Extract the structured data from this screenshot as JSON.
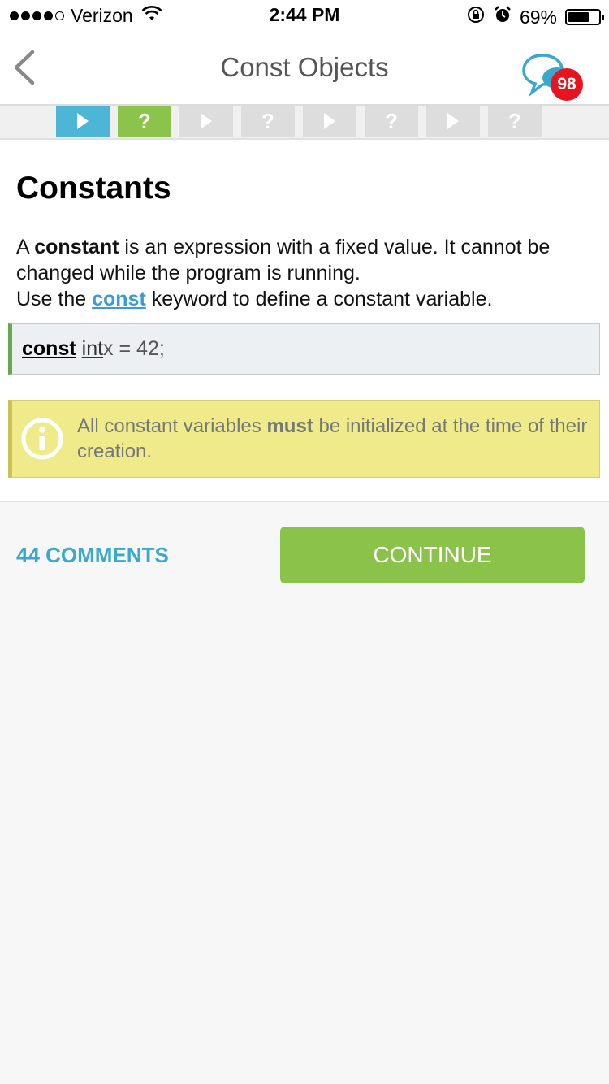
{
  "status_bar": {
    "carrier": "Verizon",
    "time": "2:44 PM",
    "battery_percent": "69%",
    "battery_level": 0.69,
    "signal_bars": 4,
    "icons": [
      "wifi-icon",
      "orientation-lock-icon",
      "alarm-icon",
      "battery-icon"
    ]
  },
  "nav": {
    "title": "Const Objects",
    "back_icon": "chevron-left-icon",
    "chat_icon": "chat-bubbles-icon",
    "badge_count": "98"
  },
  "steps": [
    {
      "type": "play",
      "symbol": "",
      "state": "active"
    },
    {
      "type": "quiz",
      "symbol": "?",
      "state": "active"
    },
    {
      "type": "play",
      "symbol": "",
      "state": "inactive"
    },
    {
      "type": "quiz",
      "symbol": "?",
      "state": "inactive"
    },
    {
      "type": "play",
      "symbol": "",
      "state": "inactive"
    },
    {
      "type": "quiz",
      "symbol": "?",
      "state": "inactive"
    },
    {
      "type": "play",
      "symbol": "",
      "state": "inactive"
    },
    {
      "type": "quiz",
      "symbol": "?",
      "state": "inactive"
    }
  ],
  "lesson": {
    "heading": "Constants",
    "p1_a": "A ",
    "p1_bold": "constant",
    "p1_b": " is an expression with a fixed value. It cannot be changed while the program is running.",
    "p2_a": "Use the ",
    "p2_link": "const",
    "p2_b": " keyword to define a constant variable.",
    "code": {
      "keyword": "const",
      "type": "int",
      "rest": " x = 42;"
    },
    "info": {
      "icon": "info-icon",
      "text_a": "All constant variables ",
      "text_bold": "must",
      "text_b": " be initialized at the time of their creation."
    }
  },
  "actions": {
    "comments_label": "44 COMMENTS",
    "continue_label": "CONTINUE"
  },
  "colors": {
    "accent_blue": "#4db5d6",
    "accent_green": "#8bc34a",
    "info_yellow": "#efea8a",
    "badge_red": "#e8141d",
    "link_blue": "#3a9bd5"
  }
}
